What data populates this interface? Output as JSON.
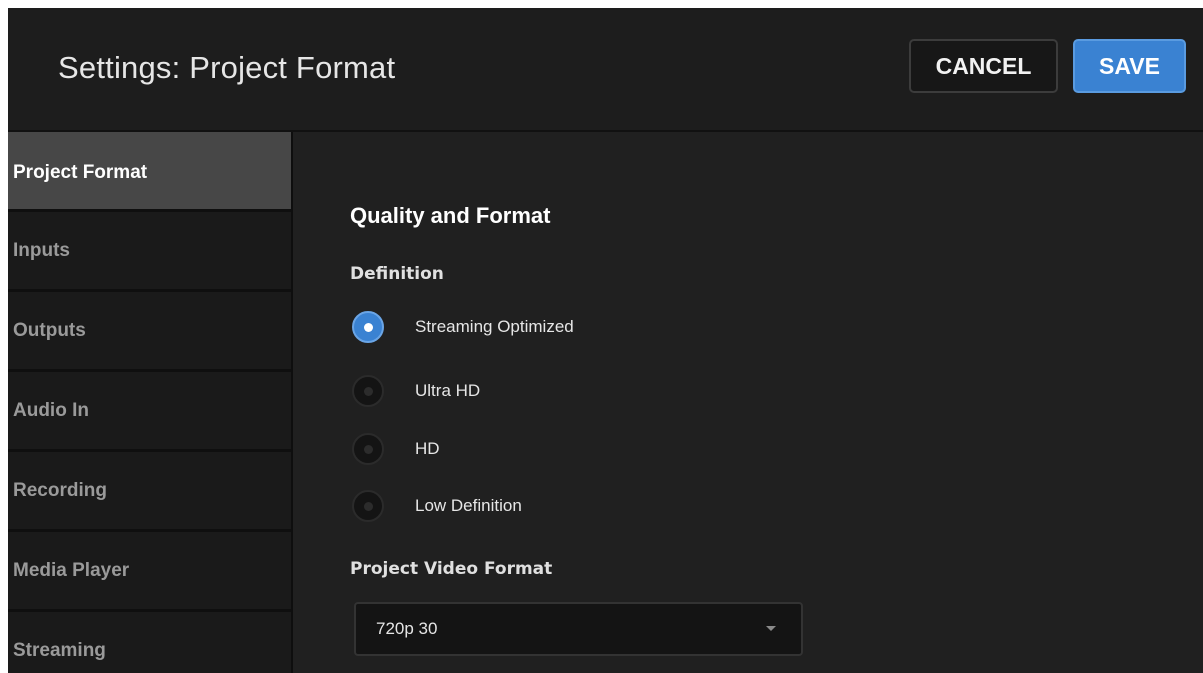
{
  "header": {
    "title": "Settings: Project Format",
    "cancel_label": "CANCEL",
    "save_label": "SAVE"
  },
  "sidebar": {
    "items": [
      {
        "label": "Project Format",
        "active": true
      },
      {
        "label": "Inputs",
        "active": false
      },
      {
        "label": "Outputs",
        "active": false
      },
      {
        "label": "Audio In",
        "active": false
      },
      {
        "label": "Recording",
        "active": false
      },
      {
        "label": "Media Player",
        "active": false
      },
      {
        "label": "Streaming",
        "active": false
      }
    ]
  },
  "content": {
    "section_title": "Quality and Format",
    "definition": {
      "label": "Definition",
      "options": [
        {
          "label": "Streaming Optimized",
          "selected": true
        },
        {
          "label": "Ultra HD",
          "selected": false
        },
        {
          "label": "HD",
          "selected": false
        },
        {
          "label": "Low Definition",
          "selected": false
        }
      ]
    },
    "video_format": {
      "label": "Project Video Format",
      "selected": "720p 30"
    }
  },
  "colors": {
    "accent": "#3a82d2",
    "background": "#202020",
    "sidebar_active": "#474747"
  }
}
